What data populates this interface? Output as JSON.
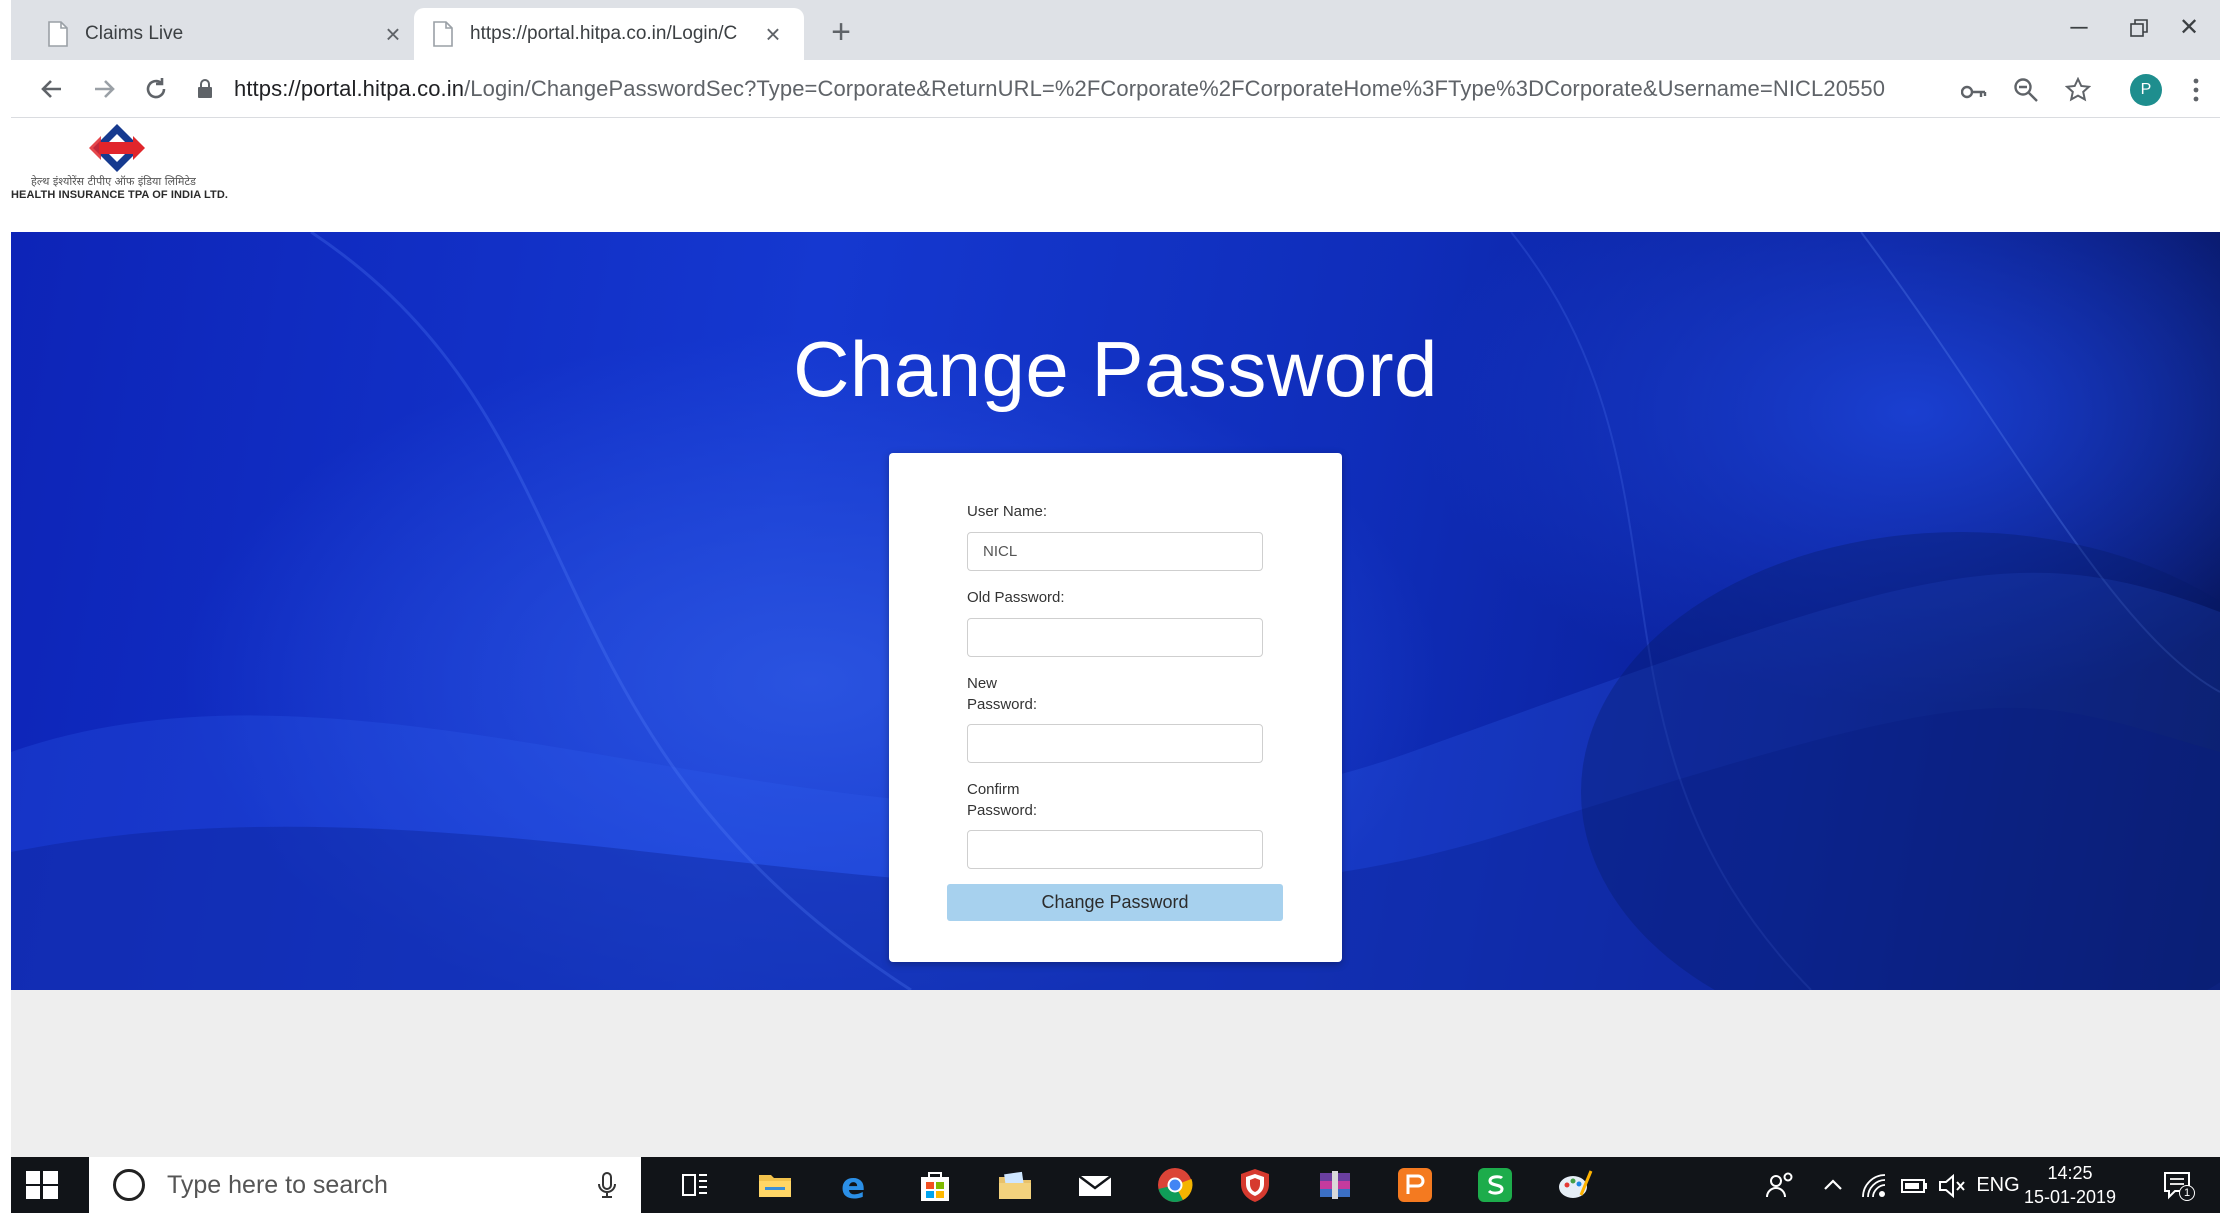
{
  "browser": {
    "tabs": [
      {
        "title": "Claims Live",
        "active": false
      },
      {
        "title": "https://portal.hitpa.co.in/Login/C",
        "active": true
      }
    ],
    "url_host": "https://portal.hitpa.co.in",
    "url_path": "/Login/ChangePasswordSec?Type=Corporate&ReturnURL=%2FCorporate%2FCorporateHome%3FType%3DCorporate&Username=NICL20550",
    "profile_initial": "P"
  },
  "site": {
    "logo_tagline": "हेल्थ इंश्योरेंस टीपीए ऑफ इंडिया लिमिटेड",
    "logo_name": "HEALTH INSURANCE TPA OF INDIA LTD.",
    "brand_colors": {
      "red": "#e0262b",
      "blue": "#163a8f"
    }
  },
  "page": {
    "title": "Change Password",
    "form": {
      "username_label": "User Name:",
      "username_value": "NICL",
      "old_password_label": "Old Password:",
      "new_password_label_1": "New",
      "new_password_label_2": "Password:",
      "confirm_password_label_1": "Confirm",
      "confirm_password_label_2": "Password:",
      "submit_label": "Change Password"
    }
  },
  "taskbar": {
    "search_placeholder": "Type here to search",
    "language": "ENG",
    "time": "14:25",
    "date": "15-01-2019",
    "notification_count": "1"
  }
}
